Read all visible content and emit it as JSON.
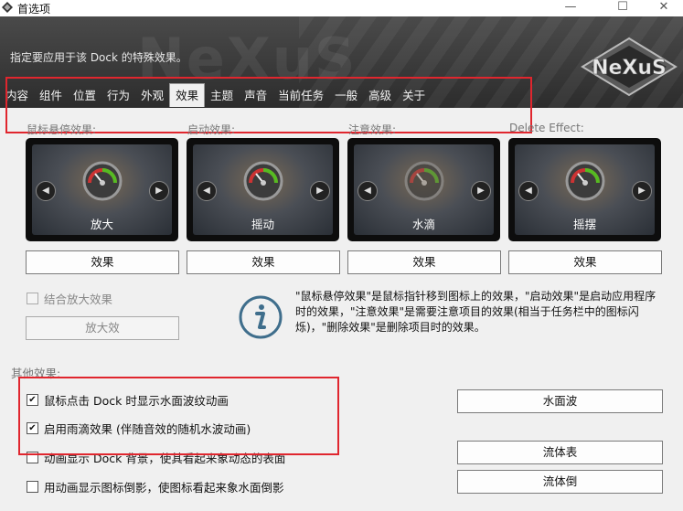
{
  "window": {
    "title": "首选项",
    "minimize": "—",
    "maximize": "☐",
    "close": "✕"
  },
  "header": {
    "description": "指定要应用于该 Dock 的特殊效果。",
    "watermark": "NeXuS",
    "logo_text": "NeXuS"
  },
  "tabs": [
    {
      "label": "内容"
    },
    {
      "label": "组件"
    },
    {
      "label": "位置"
    },
    {
      "label": "行为"
    },
    {
      "label": "外观"
    },
    {
      "label": "效果",
      "active": true
    },
    {
      "label": "主题"
    },
    {
      "label": "声音"
    },
    {
      "label": "当前任务"
    },
    {
      "label": "一般"
    },
    {
      "label": "高级"
    },
    {
      "label": "关于"
    }
  ],
  "effects": [
    {
      "label": "鼠标悬停效果:",
      "preview_name": "放大",
      "button": "效果"
    },
    {
      "label": "启动效果:",
      "preview_name": "摇动",
      "button": "效果"
    },
    {
      "label": "注意效果:",
      "preview_name": "水滴",
      "button": "效果"
    },
    {
      "label": "Delete Effect:",
      "preview_name": "摇摆",
      "button": "效果"
    }
  ],
  "combine_zoom": {
    "label": "结合放大效果",
    "checked": false,
    "button": "放大效"
  },
  "info_text": "\"鼠标悬停效果\"是鼠标指针移到图标上的效果，\"启动效果\"是启动应用程序时的效果，\"注意效果\"是需要注意项目的效果(相当于任务栏中的图标闪烁)，\"删除效果\"是删除项目时的效果。",
  "other": {
    "section_label": "其他效果:",
    "options": [
      {
        "label": "鼠标点击 Dock 时显示水面波纹动画",
        "checked": true,
        "check_mark": "✔"
      },
      {
        "label": "启用雨滴效果 (伴随音效的随机水波动画)",
        "checked": true,
        "check_mark": "✔"
      },
      {
        "label": "动画显示 Dock 背景，使其看起来象动态的表面",
        "checked": false,
        "check_mark": ""
      },
      {
        "label": "用动画显示图标倒影，使图标看起来象水面倒影",
        "checked": false,
        "check_mark": ""
      }
    ],
    "buttons": {
      "water": "水面波",
      "fluid_surface": "流体表",
      "fluid_reflection": "流体倒"
    }
  },
  "colors": {
    "highlight_box": "#e0262e",
    "header_bg": "#3a3a3a"
  },
  "icons": [
    "app-icon",
    "info-icon",
    "arrow-left-icon",
    "arrow-right-icon",
    "gauge-icon"
  ]
}
